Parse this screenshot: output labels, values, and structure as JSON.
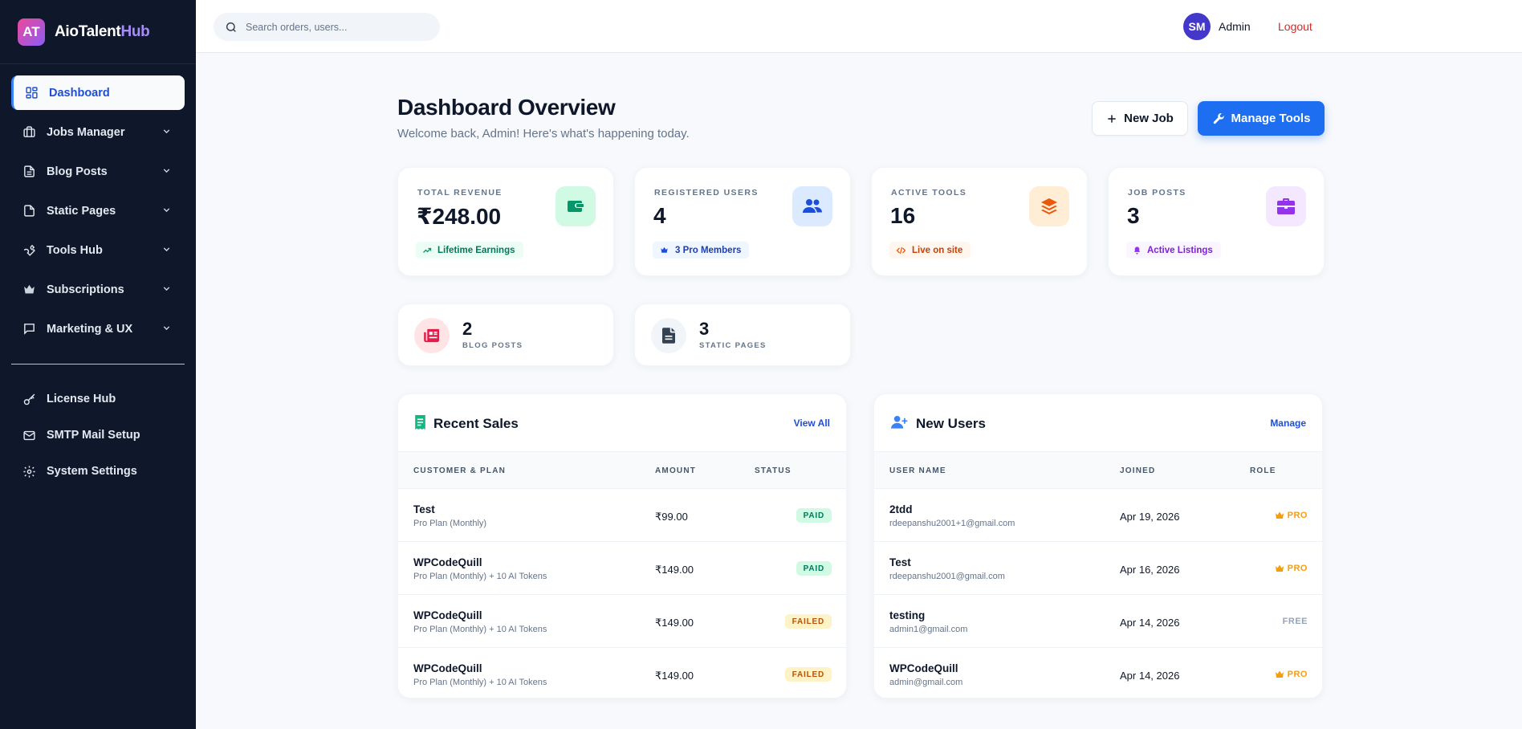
{
  "brand": {
    "logo": "AT",
    "name_main": "AioTalent",
    "name_accent": "Hub"
  },
  "search": {
    "placeholder": "Search orders, users..."
  },
  "user": {
    "initials": "SM",
    "name": "Admin",
    "logout": "Logout"
  },
  "sidebar": {
    "items": [
      {
        "label": "Dashboard",
        "icon": "dashboard-icon"
      },
      {
        "label": "Jobs Manager",
        "icon": "briefcase-icon"
      },
      {
        "label": "Blog Posts",
        "icon": "document-icon"
      },
      {
        "label": "Static Pages",
        "icon": "file-icon"
      },
      {
        "label": "Tools Hub",
        "icon": "wrench-icon"
      },
      {
        "label": "Subscriptions",
        "icon": "crown-icon"
      },
      {
        "label": "Marketing & UX",
        "icon": "chat-icon"
      }
    ],
    "bottom": [
      {
        "label": "License Hub",
        "icon": "key-icon"
      },
      {
        "label": "SMTP Mail Setup",
        "icon": "mail-icon"
      },
      {
        "label": "System Settings",
        "icon": "gear-icon"
      }
    ]
  },
  "header": {
    "title": "Dashboard Overview",
    "subtitle": "Welcome back, Admin! Here's what's happening today.",
    "new_job": "New Job",
    "manage_tools": "Manage Tools"
  },
  "stats": [
    {
      "label": "TOTAL REVENUE",
      "value": "₹248.00",
      "pill": "Lifetime Earnings",
      "icon": "wallet-icon",
      "color": "#059669",
      "bg": "#d1fae5"
    },
    {
      "label": "REGISTERED USERS",
      "value": "4",
      "pill": "3 Pro Members",
      "icon": "users-icon",
      "color": "#1d4ed8",
      "bg": "#dbeafe"
    },
    {
      "label": "ACTIVE TOOLS",
      "value": "16",
      "pill": "Live on site",
      "icon": "layers-icon",
      "color": "#ea580c",
      "bg": "#ffedd5"
    },
    {
      "label": "JOB POSTS",
      "value": "3",
      "pill": "Active Listings",
      "icon": "briefcase-icon",
      "color": "#9333ea",
      "bg": "#f3e8ff"
    }
  ],
  "mini": [
    {
      "num": "2",
      "label": "BLOG POSTS",
      "icon": "newspaper-icon"
    },
    {
      "num": "3",
      "label": "STATIC PAGES",
      "icon": "file-icon"
    }
  ],
  "sales": {
    "title": "Recent Sales",
    "link": "View All",
    "columns": [
      "CUSTOMER & PLAN",
      "AMOUNT",
      "STATUS"
    ],
    "rows": [
      {
        "name": "Test",
        "plan": "Pro Plan (Monthly)",
        "amount": "₹99.00",
        "status": "PAID"
      },
      {
        "name": "WPCodeQuill",
        "plan": "Pro Plan (Monthly) + 10 AI Tokens",
        "amount": "₹149.00",
        "status": "PAID"
      },
      {
        "name": "WPCodeQuill",
        "plan": "Pro Plan (Monthly) + 10 AI Tokens",
        "amount": "₹149.00",
        "status": "FAILED"
      },
      {
        "name": "WPCodeQuill",
        "plan": "Pro Plan (Monthly) + 10 AI Tokens",
        "amount": "₹149.00",
        "status": "FAILED"
      }
    ]
  },
  "users": {
    "title": "New Users",
    "link": "Manage",
    "columns": [
      "USER NAME",
      "JOINED",
      "ROLE"
    ],
    "rows": [
      {
        "name": "2tdd",
        "email": "rdeepanshu2001+1@gmail.com",
        "joined": "Apr 19, 2026",
        "role": "PRO"
      },
      {
        "name": "Test",
        "email": "rdeepanshu2001@gmail.com",
        "joined": "Apr 16, 2026",
        "role": "PRO"
      },
      {
        "name": "testing",
        "email": "admin1@gmail.com",
        "joined": "Apr 14, 2026",
        "role": "FREE"
      },
      {
        "name": "WPCodeQuill",
        "email": "admin@gmail.com",
        "joined": "Apr 14, 2026",
        "role": "PRO"
      }
    ]
  }
}
